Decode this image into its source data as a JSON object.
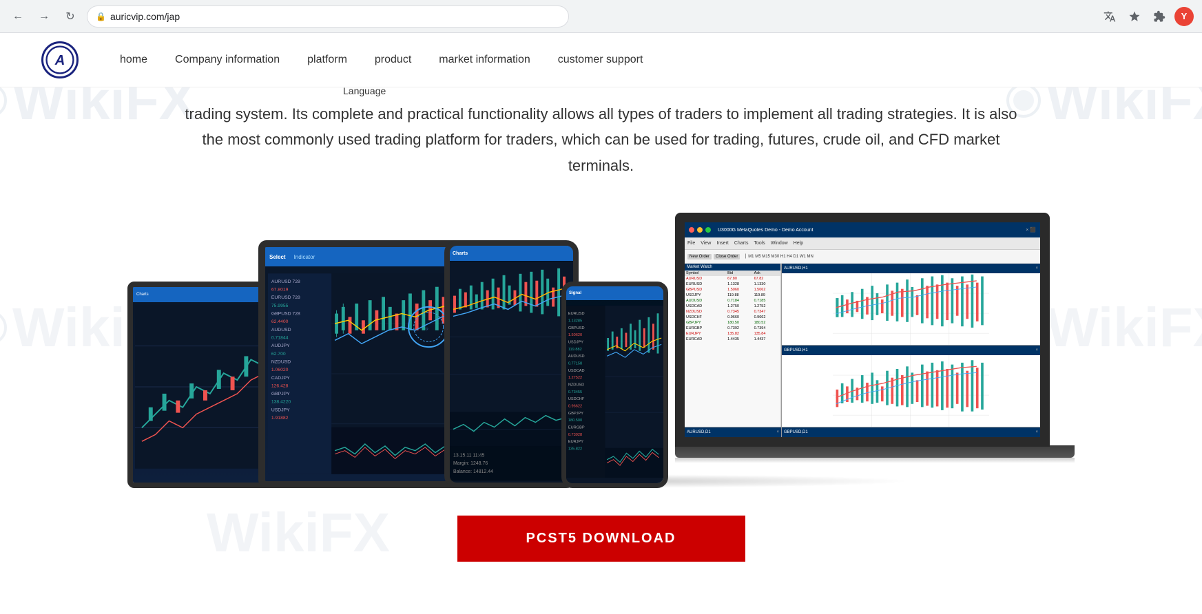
{
  "browser": {
    "back_label": "←",
    "forward_label": "→",
    "refresh_label": "↻",
    "url": "auricvip.com/jap",
    "translate_icon": "T",
    "star_icon": "☆",
    "extension_icon": "⊡",
    "avatar_label": "Y"
  },
  "nav": {
    "logo_alt": "Auric VIP Logo",
    "items": [
      {
        "id": "home",
        "label": "home"
      },
      {
        "id": "company",
        "label": "Company information"
      },
      {
        "id": "platform",
        "label": "platform"
      },
      {
        "id": "product",
        "label": "product"
      },
      {
        "id": "market",
        "label": "market information"
      },
      {
        "id": "support",
        "label": "customer support"
      }
    ],
    "language_label": "Language"
  },
  "main": {
    "description": "trading system. Its complete and practical functionality allows all types of traders to implement all trading strategies. It is also the most commonly used trading platform for traders, which can be used for trading, futures, crude oil, and CFD market terminals.",
    "download_button_label": "PCST5 DOWNLOAD",
    "wikifx_watermark": "WikiFX"
  }
}
